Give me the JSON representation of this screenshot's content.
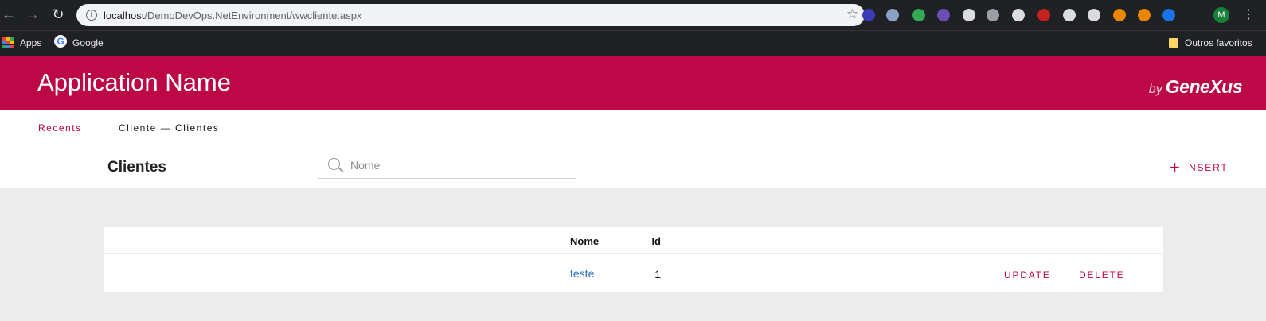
{
  "browser": {
    "url_host": "localhost",
    "url_path": "/DemoDevOps.NetEnvironment/wwcliente.aspx",
    "bookmarks": {
      "apps": "Apps",
      "google": "Google",
      "other": "Outros favoritos"
    },
    "avatar_initial": "M",
    "extension_colors": [
      "#3b3bb8",
      "#8aa0c4",
      "#34a853",
      "#6a4fb5",
      "#dadce0",
      "#9aa0a6",
      "#dadce0",
      "#c5221f",
      "#dadce0",
      "#dadce0",
      "#ea8600",
      "#ea8600",
      "#1a73e8"
    ]
  },
  "header": {
    "app_name": "Application Name",
    "brand_by": "by",
    "brand_name": "GeneXus"
  },
  "breadcrumb": {
    "recents": "Recents",
    "parent": "Cliente",
    "separator": "—",
    "current": "Clientes"
  },
  "page": {
    "title": "Clientes",
    "search_placeholder": "Nome",
    "insert_label": "INSERT"
  },
  "grid": {
    "columns": {
      "id": "Id",
      "name": "Nome"
    },
    "rows": [
      {
        "id": "1",
        "name": "teste",
        "update": "UPDATE",
        "delete": "DELETE"
      }
    ]
  },
  "colors": {
    "accent": "#bc0847",
    "link": "#3273b8",
    "background": "#ececec"
  }
}
